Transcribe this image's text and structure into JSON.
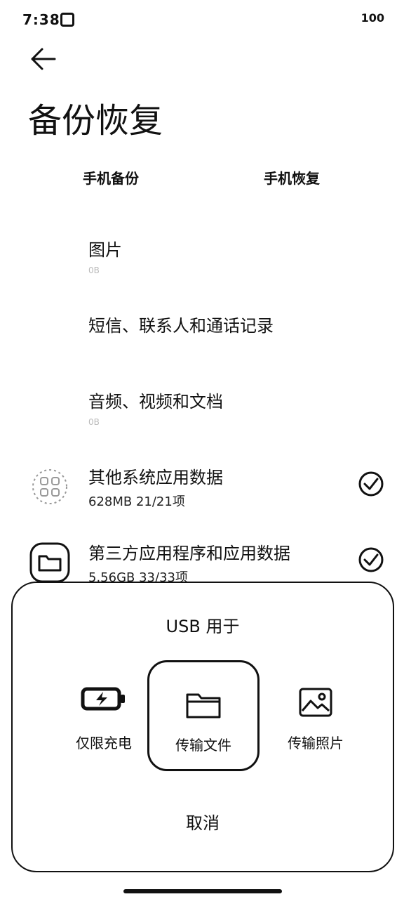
{
  "status": {
    "time": "7:38",
    "right": "100"
  },
  "page": {
    "title": "备份恢复"
  },
  "tabs": [
    {
      "label": "手机备份"
    },
    {
      "label": "手机恢复"
    }
  ],
  "items": [
    {
      "title": "图片",
      "subtitle": "0B"
    },
    {
      "title": "短信、联系人和通话记录",
      "subtitle": ""
    },
    {
      "title": "音频、视频和文档",
      "subtitle": "0B"
    },
    {
      "title": "其他系统应用数据",
      "subtitle": "628MB  21/21项"
    },
    {
      "title": "第三方应用程序和应用数据",
      "subtitle": "5.56GB  33/33项"
    }
  ],
  "usb_sheet": {
    "title": "USB 用于",
    "options": [
      {
        "label": "仅限充电",
        "icon": "battery-charge-icon"
      },
      {
        "label": "传输文件",
        "icon": "folder-icon",
        "selected": true
      },
      {
        "label": "传输照片",
        "icon": "image-icon"
      }
    ],
    "cancel": "取消"
  }
}
